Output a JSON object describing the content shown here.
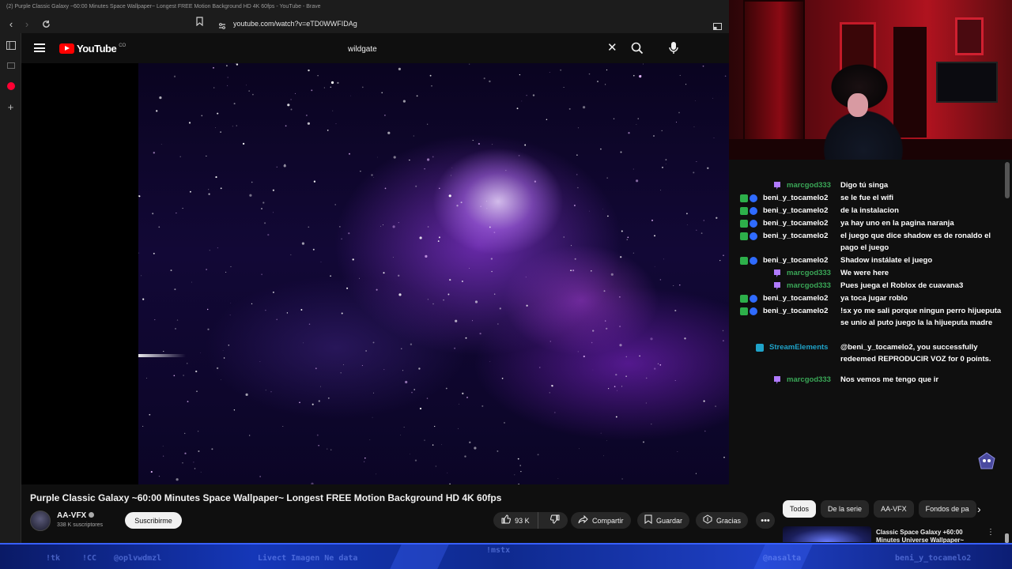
{
  "browser": {
    "window_title": "(2) Purple Classic Galaxy ~60:00 Minutes Space Wallpaper~ Longest FREE Motion Background HD 4K 60fps - YouTube - Brave",
    "url": "youtube.com/watch?v=eTD0WWFIDAg"
  },
  "youtube": {
    "logo_text": "YouTube",
    "country_code": "CO",
    "search_value": "wildgate",
    "video_title": "Purple Classic Galaxy ~60:00 Minutes Space Wallpaper~ Longest FREE Motion Background HD 4K 60fps",
    "channel_name": "AA-VFX",
    "subscribers": "338 K suscriptores",
    "subscribe_label": "Suscribirme",
    "likes": "93 K",
    "share_label": "Compartir",
    "save_label": "Guardar",
    "thanks_label": "Gracias",
    "chips": [
      "Todos",
      "De la serie",
      "AA-VFX",
      "Fondos de pa"
    ],
    "recommended_title": "Classic Space Galaxy +60:00 Minutes Universe Wallpaper~"
  },
  "chat": {
    "messages": [
      {
        "user": "marcgod333",
        "text": "Digo tú singa",
        "color": "#3aa757",
        "badges": [
          "purple"
        ]
      },
      {
        "user": "beni_y_tocamelo2",
        "text": "se le fue el wifi",
        "color": "#ffffff",
        "badges": [
          "green",
          "blue"
        ]
      },
      {
        "user": "beni_y_tocamelo2",
        "text": "de la instalacion",
        "color": "#ffffff",
        "badges": [
          "green",
          "blue"
        ]
      },
      {
        "user": "beni_y_tocamelo2",
        "text": "ya hay uno en la pagina naranja",
        "color": "#ffffff",
        "badges": [
          "green",
          "blue"
        ]
      },
      {
        "user": "beni_y_tocamelo2",
        "text": "el juego que dice shadow es de ronaldo el pago el juego",
        "color": "#ffffff",
        "badges": [
          "green",
          "blue"
        ]
      },
      {
        "user": "beni_y_tocamelo2",
        "text": "Shadow instálate el juego",
        "color": "#ffffff",
        "badges": [
          "green",
          "blue"
        ]
      },
      {
        "user": "marcgod333",
        "text": "We were here",
        "color": "#3aa757",
        "badges": [
          "purple"
        ]
      },
      {
        "user": "marcgod333",
        "text": "Pues juega el Roblox de cuavana3",
        "color": "#3aa757",
        "badges": [
          "purple"
        ]
      },
      {
        "user": "beni_y_tocamelo2",
        "text": "ya toca jugar roblo",
        "color": "#ffffff",
        "badges": [
          "green",
          "blue"
        ]
      },
      {
        "user": "beni_y_tocamelo2",
        "text": "!sx yo me sali porque ningun perro hijueputa se unio al puto juego la la hijueputa madre",
        "color": "#ffffff",
        "badges": [
          "green",
          "blue"
        ]
      },
      {
        "user": "StreamElements",
        "text": "@beni_y_tocamelo2, you successfully redeemed REPRODUCIR VOZ for 0 points.",
        "color": "#1fa3c9",
        "badges": [
          "cyan"
        ]
      },
      {
        "user": "marcgod333",
        "text": "Nos vemos me tengo que ir",
        "color": "#3aa757",
        "badges": [
          "purple"
        ]
      }
    ]
  },
  "overlay": {
    "items": [
      "!tk",
      "!CC",
      "@oplvwdmzl",
      "Livect Imagen Ne data",
      "!mstx",
      "@nasalta",
      "beni_y_tocamelo2"
    ]
  },
  "colors": {
    "youtube_red": "#ff0000",
    "chat_green_user": "#3aa757",
    "overlay_blue": "#1537b8"
  }
}
